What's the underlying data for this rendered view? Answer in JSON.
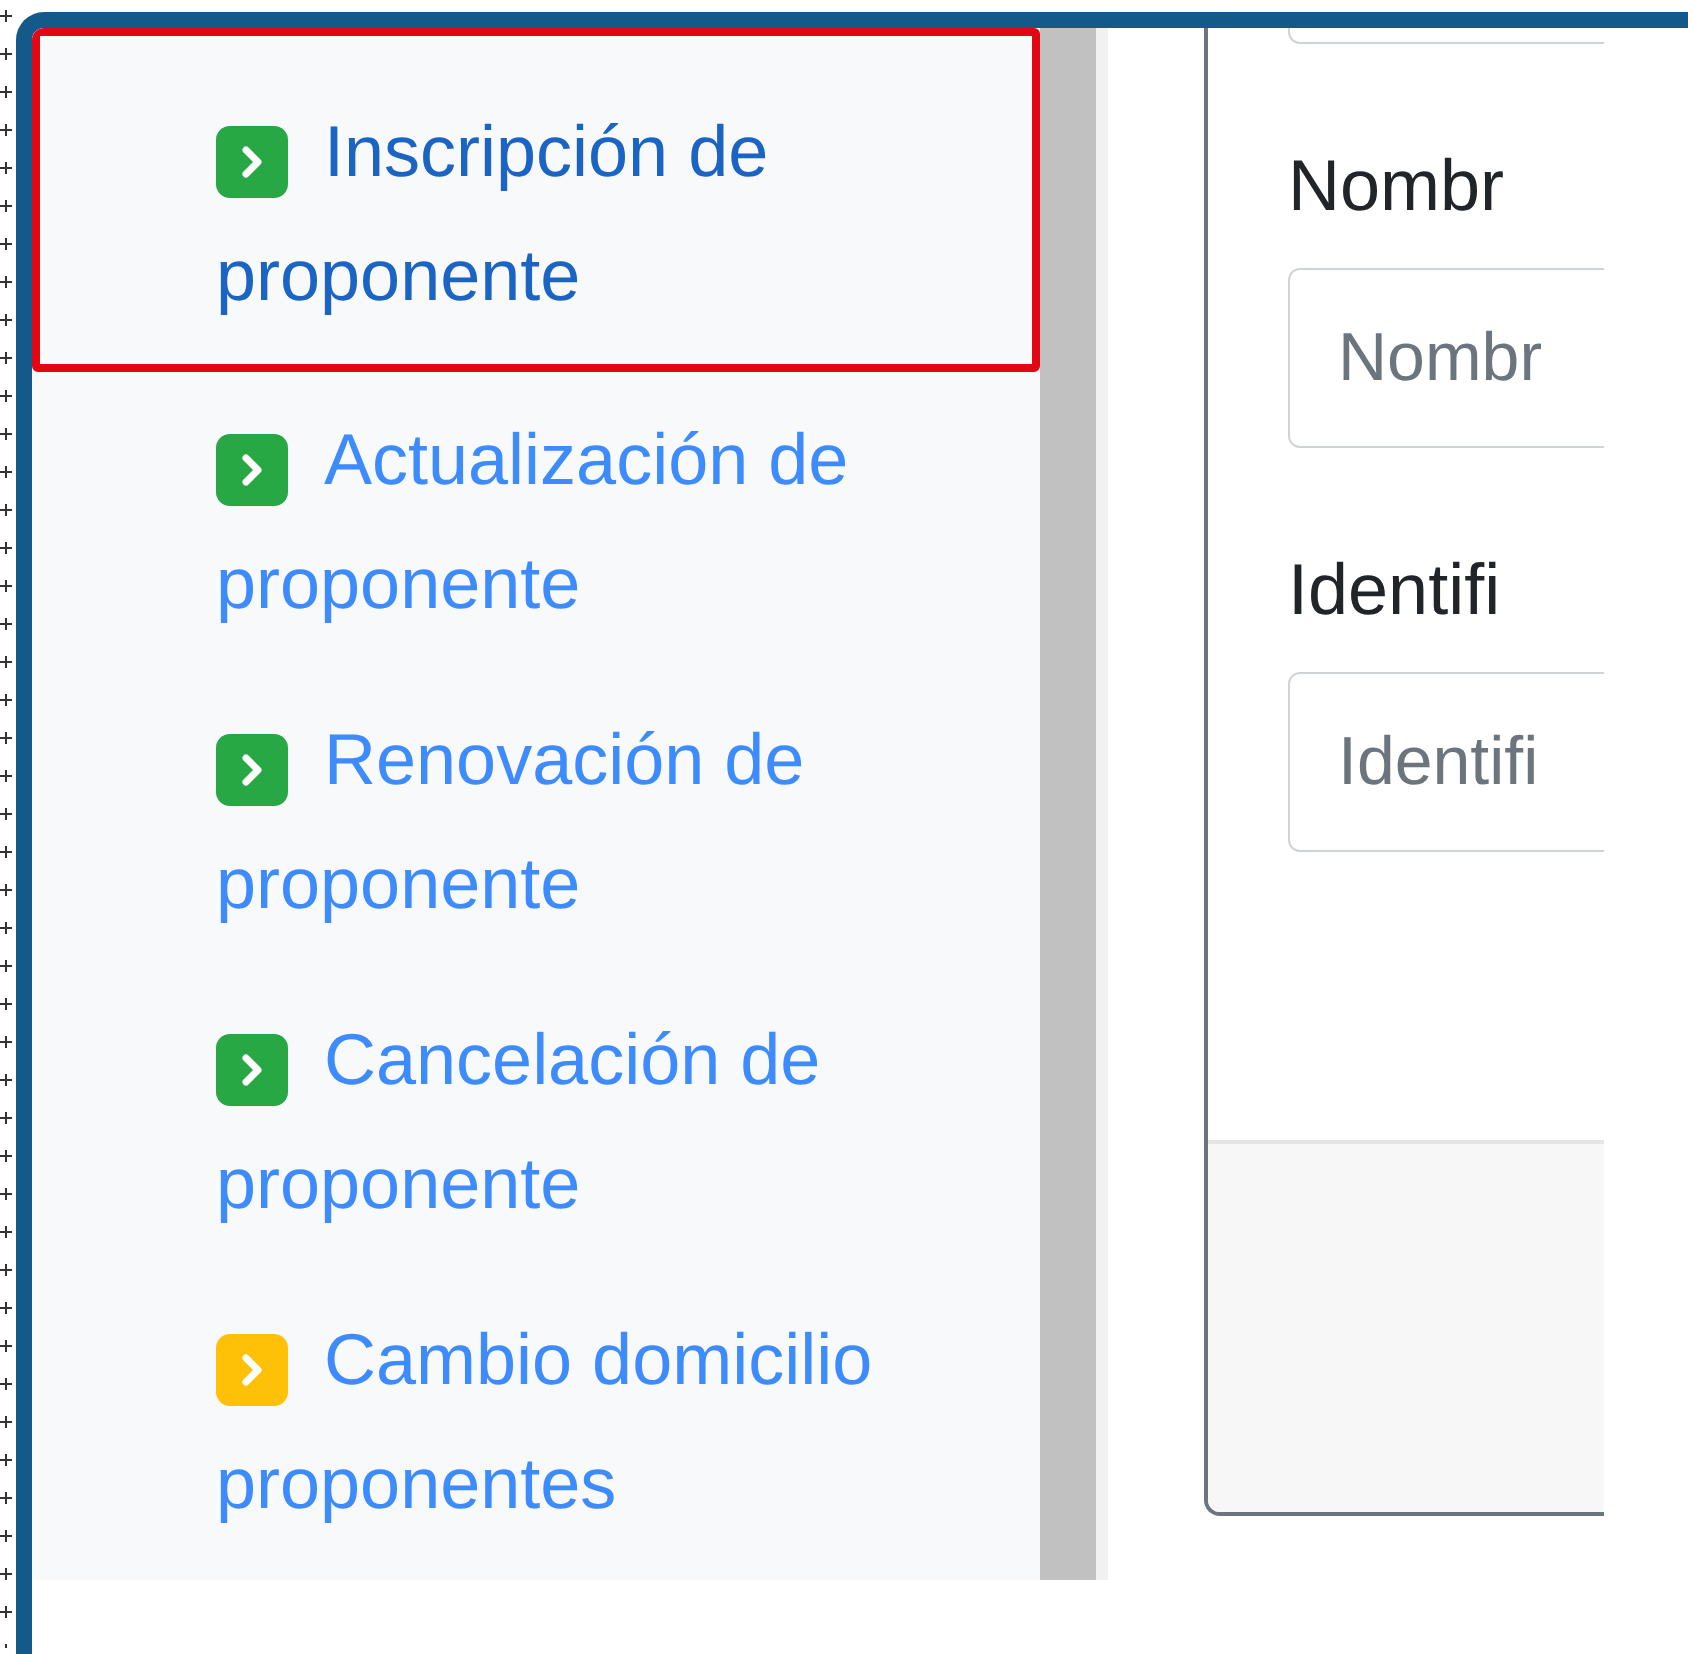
{
  "sidebar": {
    "items": [
      {
        "label": "Inscripción de proponente",
        "selected": true,
        "kind": "done"
      },
      {
        "label": "Actualización de proponente",
        "selected": false,
        "kind": "done"
      },
      {
        "label": "Renovación de proponente",
        "selected": false,
        "kind": "done"
      },
      {
        "label": "Cancelación de proponente",
        "selected": false,
        "kind": "done"
      },
      {
        "label": "Cambio domicilio proponentes",
        "selected": false,
        "kind": "pending"
      }
    ]
  },
  "form": {
    "fields": [
      {
        "label": "Nombr",
        "placeholder": "Nombr"
      },
      {
        "label": "Identifi",
        "placeholder": "Identifi"
      }
    ]
  }
}
